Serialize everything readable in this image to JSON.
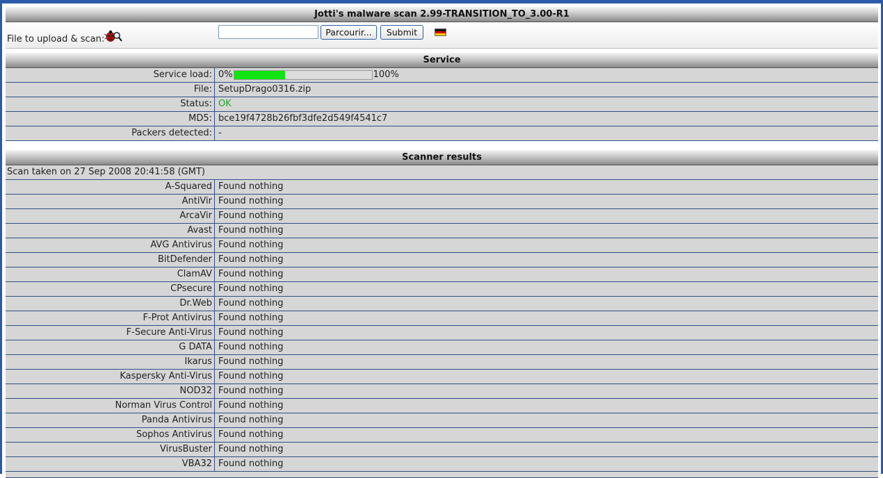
{
  "header": {
    "title": "Jotti's malware scan 2.99-TRANSITION_TO_3.00-R1"
  },
  "upload": {
    "label": "File to upload & scan:",
    "file_value": "",
    "browse_label": "Parcourir...",
    "submit_label": "Submit",
    "bug_icon": "ladybug-magnifier-icon",
    "flag_icon": "german-flag-icon"
  },
  "service": {
    "title": "Service",
    "load_label": "Service load:",
    "load_min": "0%",
    "load_max": "100%",
    "load_fraction": 0.37,
    "file_label": "File:",
    "file_value": "SetupDrago0316.zip",
    "status_label": "Status:",
    "status_value": "OK",
    "status_color": "#22aa22",
    "md5_label": "MD5:",
    "md5_value": "bce19f4728b26fbf3dfe2d549f4541c7",
    "packers_label": "Packers detected:",
    "packers_value": "-"
  },
  "results": {
    "title": "Scanner results",
    "scan_date": "Scan taken on 27 Sep 2008 20:41:58 (GMT)",
    "scanners": [
      {
        "name": "A-Squared",
        "result": "Found nothing"
      },
      {
        "name": "AntiVir",
        "result": "Found nothing"
      },
      {
        "name": "ArcaVir",
        "result": "Found nothing"
      },
      {
        "name": "Avast",
        "result": "Found nothing"
      },
      {
        "name": "AVG Antivirus",
        "result": "Found nothing"
      },
      {
        "name": "BitDefender",
        "result": "Found nothing"
      },
      {
        "name": "ClamAV",
        "result": "Found nothing"
      },
      {
        "name": "CPsecure",
        "result": "Found nothing"
      },
      {
        "name": "Dr.Web",
        "result": "Found nothing"
      },
      {
        "name": "F-Prot Antivirus",
        "result": "Found nothing"
      },
      {
        "name": "F-Secure Anti-Virus",
        "result": "Found nothing"
      },
      {
        "name": "G DATA",
        "result": "Found nothing"
      },
      {
        "name": "Ikarus",
        "result": "Found nothing"
      },
      {
        "name": "Kaspersky Anti-Virus",
        "result": "Found nothing"
      },
      {
        "name": "NOD32",
        "result": "Found nothing"
      },
      {
        "name": "Norman Virus Control",
        "result": "Found nothing"
      },
      {
        "name": "Panda Antivirus",
        "result": "Found nothing"
      },
      {
        "name": "Sophos Antivirus",
        "result": "Found nothing"
      },
      {
        "name": "VirusBuster",
        "result": "Found nothing"
      },
      {
        "name": "VBA32",
        "result": "Found nothing"
      }
    ]
  }
}
